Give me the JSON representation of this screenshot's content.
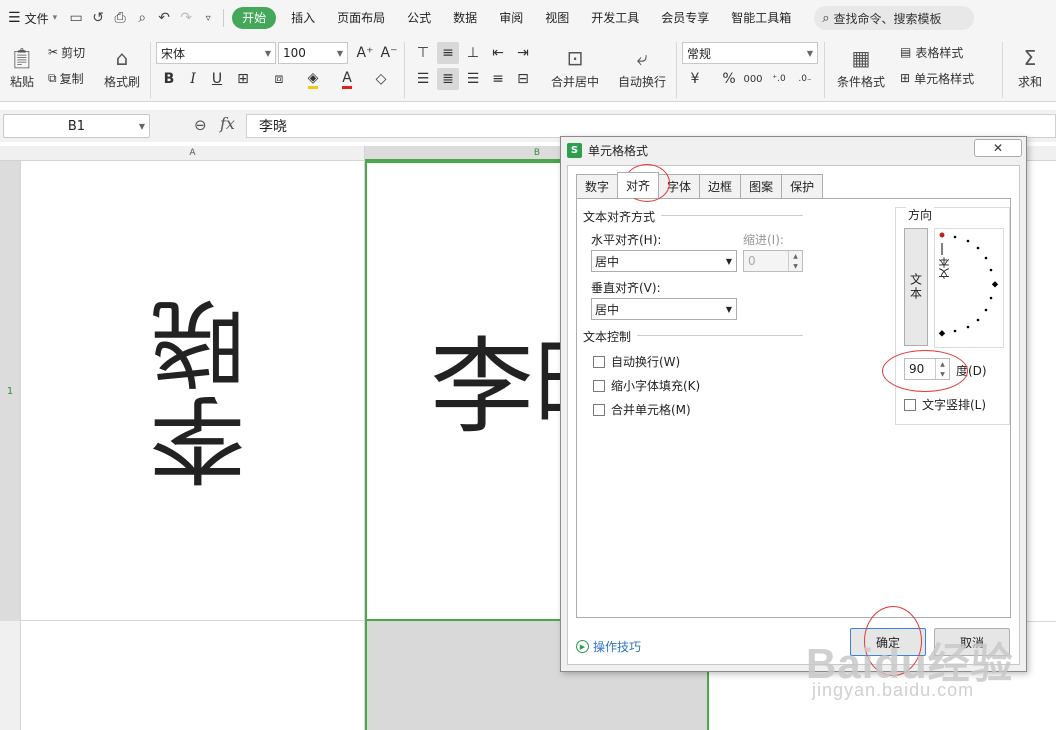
{
  "menubar": {
    "file_label": "文件",
    "tabs": [
      "开始",
      "插入",
      "页面布局",
      "公式",
      "数据",
      "审阅",
      "视图",
      "开发工具",
      "会员专享",
      "智能工具箱"
    ],
    "search_placeholder": "查找命令、搜索模板"
  },
  "ribbon": {
    "paste": "粘贴",
    "cut": "剪切",
    "copy": "复制",
    "format_painter": "格式刷",
    "font_name": "宋体",
    "font_size": "100",
    "merge_center": "合并居中",
    "wrap_text": "自动换行",
    "number_format": "常规",
    "conditional_format": "条件格式",
    "table_style": "表格样式",
    "cell_style": "单元格样式",
    "sum": "求和"
  },
  "formula_bar": {
    "name_box": "B1",
    "fx": "fx",
    "content": "李晓"
  },
  "sheet": {
    "columns": [
      "A",
      "B"
    ],
    "rows": [
      "1"
    ],
    "cell_a1": "李晓",
    "cell_b1": "李晓"
  },
  "dialog": {
    "title": "单元格格式",
    "close": "✕",
    "tabs": [
      "数字",
      "对齐",
      "字体",
      "边框",
      "图案",
      "保护"
    ],
    "active_tab": "对齐",
    "text_align_group": "文本对齐方式",
    "horizontal_label": "水平对齐(H):",
    "horizontal_value": "居中",
    "indent_label": "缩进(I):",
    "indent_value": "0",
    "vertical_label": "垂直对齐(V):",
    "vertical_value": "居中",
    "text_control_group": "文本控制",
    "wrap_text": "自动换行(W)",
    "shrink_to_fit": "缩小字体填充(K)",
    "merge_cells": "合并单元格(M)",
    "orientation_group": "方向",
    "orientation_vertical_text": "文本",
    "orientation_dial_text": "文本",
    "degrees_value": "90",
    "degrees_label": "度(D)",
    "vertical_text_checkbox": "文字竖排(L)",
    "tips_link": "操作技巧",
    "ok": "确定",
    "cancel": "取消"
  },
  "watermark": {
    "logo": "Baidu经验",
    "url": "jingyan.baidu.com"
  },
  "colors": {
    "accent_green": "#44a85a",
    "annotation_red": "#e23b3b",
    "link_blue": "#2d73c9"
  }
}
